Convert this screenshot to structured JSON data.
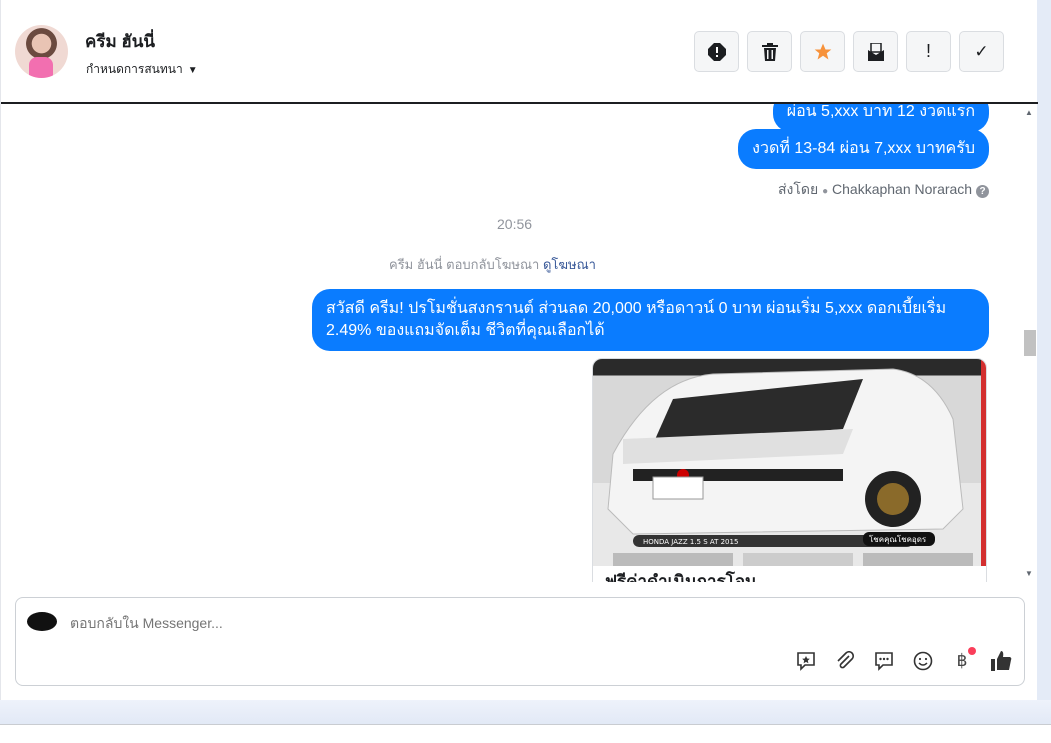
{
  "header": {
    "contact_name": "ครีม ฮันนี่",
    "assign_label": "กำหนดการสนทนา",
    "actions": [
      {
        "name": "spam",
        "icon": "alert-octagon-icon"
      },
      {
        "name": "delete",
        "icon": "trash-icon"
      },
      {
        "name": "star",
        "icon": "star-icon"
      },
      {
        "name": "mark-unread",
        "icon": "envelope-icon"
      },
      {
        "name": "follow-up",
        "icon": "exclamation-icon"
      },
      {
        "name": "done",
        "icon": "check-icon"
      }
    ],
    "star_color": "#f7923b"
  },
  "messages": {
    "bubble_partial": "ผ่อน 5,xxx บาท 12 งวดแรก",
    "bubble_2": "งวดที่ 13-84 ผ่อน 7,xxx บาทครับ",
    "sent_by_label": "ส่งโดย",
    "sent_by_name": "Chakkaphan Norarach",
    "timestamp": "20:56",
    "ad_reply_text": "ครีม ฮันนี่ ตอบกลับโฆษณา",
    "ad_reply_link": "ดูโฆษณา",
    "promo": "สวัสดี ครีม! ปรโมชั่นสงกรานต์ ส่วนลด 20,000 หรือดาวน์ 0 บาท ผ่อนเริ่ม 5,xxx ดอกเบี้ยเริ่ม 2.49% ของแถมจัดเต็ม ชีวิตที่คุณเลือกได้",
    "card_title": "ฟรีค่าดำเนินการโอน",
    "card_image_caption": "HONDA JAZZ 1.5 S AT 2015",
    "card_image_badge": "โชคคุณโชคอุดร",
    "bubble_color": "#0a7cff"
  },
  "composer": {
    "placeholder": "ตอบกลับใน Messenger...",
    "tools": [
      "saved-reply-icon",
      "paperclip-icon",
      "chat-icon",
      "emoji-icon",
      "baht-icon",
      "thumbs-up-icon"
    ],
    "baht_symbol": "฿"
  }
}
